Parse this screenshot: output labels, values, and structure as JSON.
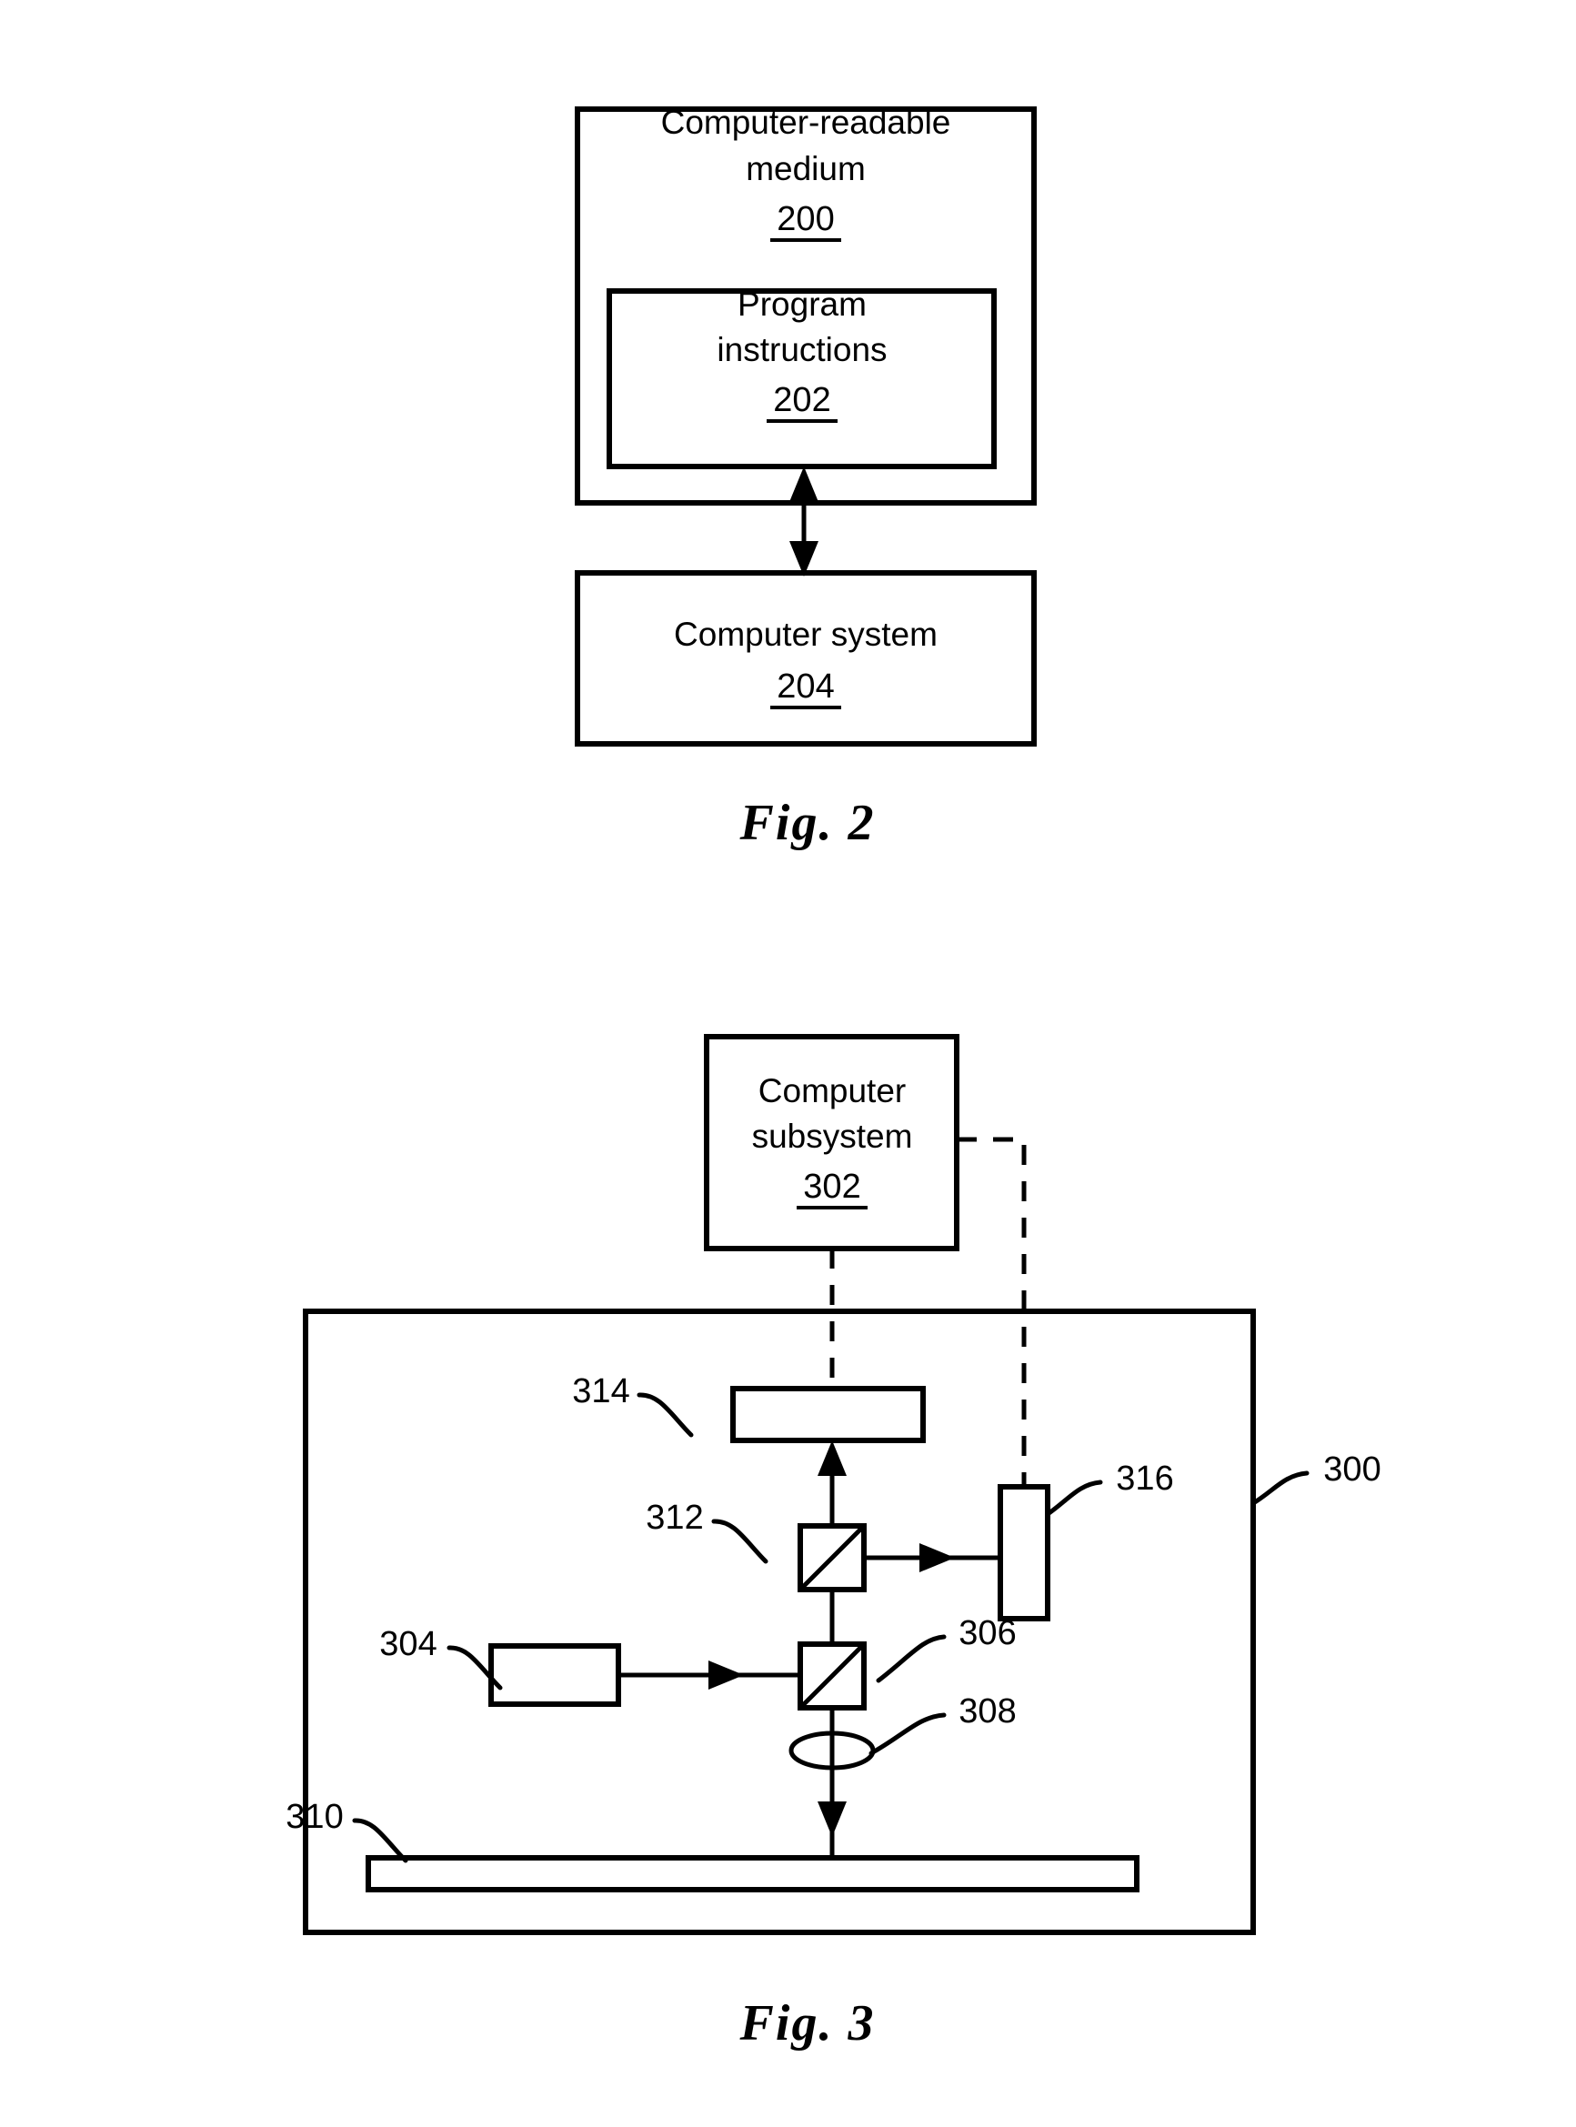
{
  "document": {
    "kind": "patent-drawing-sheet",
    "background_color": "#ffffff",
    "ink_color": "#000000"
  },
  "figures": [
    {
      "id": "figure-2",
      "caption": "Fig. 2",
      "blocks": [
        {
          "key": "computer_readable_medium",
          "label_line1": "Computer-readable",
          "label_line2": "medium",
          "ref": "200"
        },
        {
          "key": "program_instructions",
          "label_line1": "Program",
          "label_line2": "instructions",
          "ref": "202"
        },
        {
          "key": "computer_system",
          "label_line1": "Computer system",
          "label_line2": "",
          "ref": "204"
        }
      ],
      "connectors": [
        {
          "key": "medium-to-system",
          "style": "solid",
          "arrowheads": "both"
        }
      ]
    },
    {
      "id": "figure-3",
      "caption": "Fig. 3",
      "blocks": [
        {
          "key": "computer_subsystem",
          "label_line1": "Computer",
          "label_line2": "subsystem",
          "ref": "302"
        }
      ],
      "callouts": [
        {
          "key": "system",
          "ref": "300"
        },
        {
          "key": "light_source",
          "ref": "304"
        },
        {
          "key": "beam_splitter_lower",
          "ref": "306"
        },
        {
          "key": "lens",
          "ref": "308"
        },
        {
          "key": "specimen",
          "ref": "310"
        },
        {
          "key": "beam_splitter_upper",
          "ref": "312"
        },
        {
          "key": "detector_top",
          "ref": "314"
        },
        {
          "key": "detector_side",
          "ref": "316"
        }
      ],
      "connectors": [
        {
          "key": "subsystem-to-detector-314",
          "style": "dashed",
          "arrowheads": "none"
        },
        {
          "key": "subsystem-to-detector-316",
          "style": "dashed",
          "arrowheads": "none"
        },
        {
          "key": "source-to-bs306",
          "style": "solid",
          "arrowheads": "end"
        },
        {
          "key": "bs306-through-lens-to-specimen",
          "style": "solid",
          "arrowheads": "end"
        },
        {
          "key": "bs306-up-to-bs312",
          "style": "solid",
          "arrowheads": "none"
        },
        {
          "key": "bs312-up-to-detector-314",
          "style": "solid",
          "arrowheads": "end"
        },
        {
          "key": "bs312-right-to-detector-316",
          "style": "solid",
          "arrowheads": "end"
        }
      ]
    }
  ]
}
